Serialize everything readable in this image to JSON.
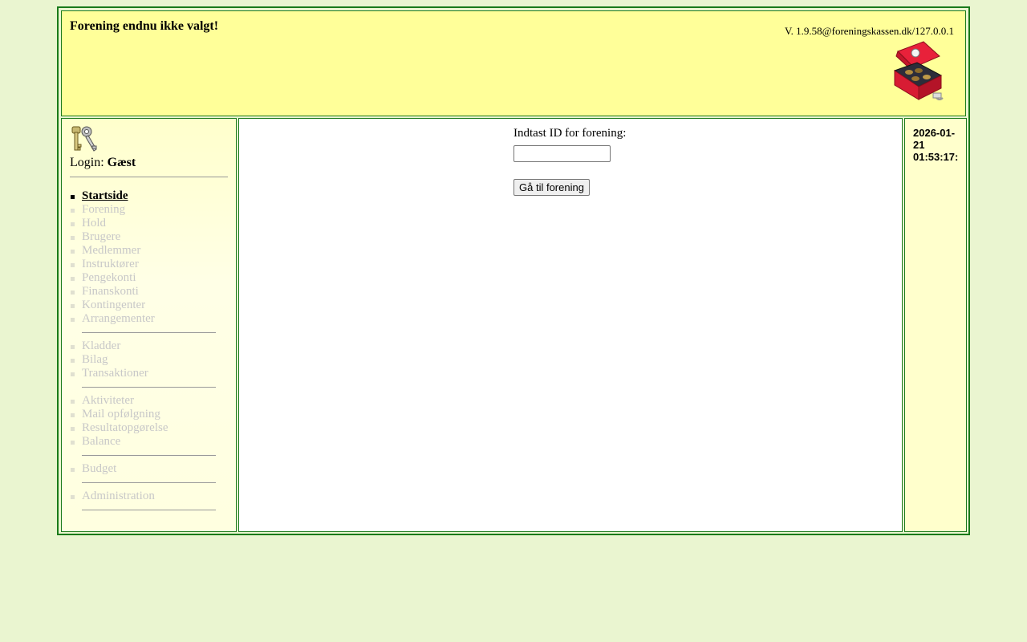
{
  "header": {
    "title": "Forening endnu ikke valgt!",
    "version": "V. 1.9.58@foreningskassen.dk/127.0.0.1",
    "logo_icon": "cashbox-icon"
  },
  "sidebar": {
    "login_icon": "keys-icon",
    "login_label": "Login:",
    "login_user": "Gæst",
    "menu": [
      {
        "label": "Startside",
        "active": true
      },
      {
        "label": "Forening"
      },
      {
        "label": "Hold"
      },
      {
        "label": "Brugere"
      },
      {
        "label": "Medlemmer"
      },
      {
        "label": "Instruktører"
      },
      {
        "label": "Pengekonti"
      },
      {
        "label": "Finanskonti"
      },
      {
        "label": "Kontingenter"
      },
      {
        "label": "Arrangementer"
      },
      {
        "label": "Kladder"
      },
      {
        "label": "Bilag"
      },
      {
        "label": "Transaktioner"
      },
      {
        "label": "Aktiviteter"
      },
      {
        "label": "Mail opfølgning"
      },
      {
        "label": "Resultatopgørelse"
      },
      {
        "label": "Balance"
      },
      {
        "label": "Budget"
      },
      {
        "label": "Administration"
      }
    ]
  },
  "main": {
    "prompt": "Indtast ID for forening:",
    "id_value": "",
    "go_button": "Gå til forening"
  },
  "clock": {
    "datetime": "2026-01-21 01:53:17:"
  },
  "colors": {
    "page_bg": "#eaf5d0",
    "header_bg": "#ffff99",
    "border": "#1a7a1a",
    "menu_disabled": "#c8c8c8"
  }
}
